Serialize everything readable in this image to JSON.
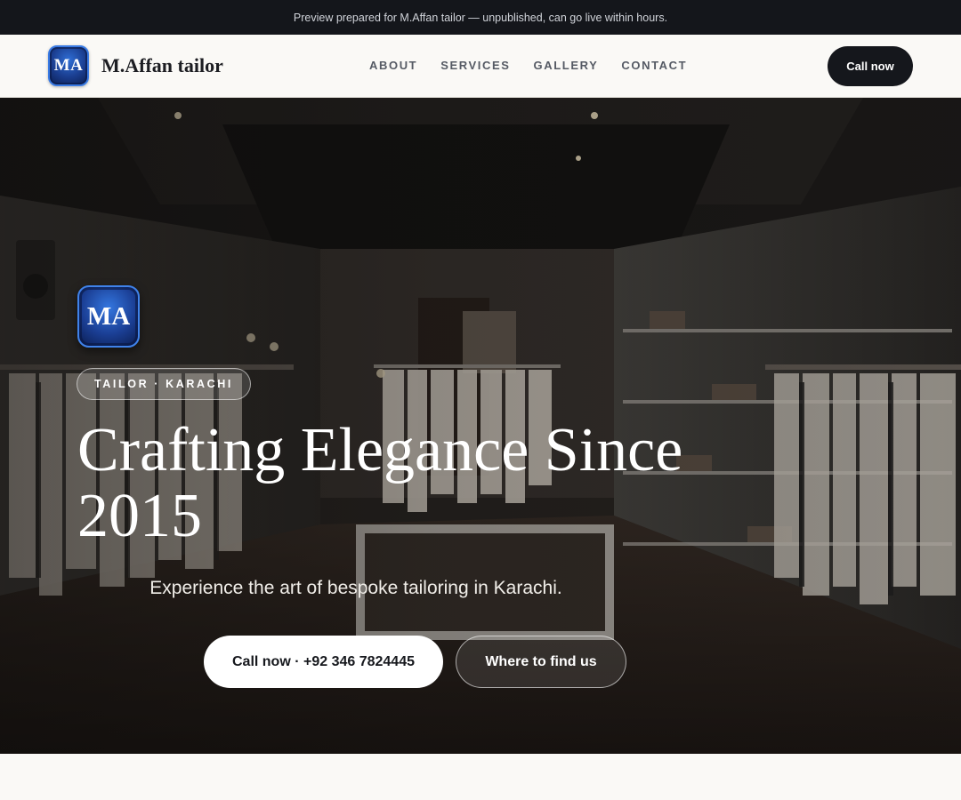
{
  "preview_banner": {
    "text": "Preview prepared for M.Affan tailor — unpublished, can go live within hours."
  },
  "header": {
    "logo_text": "MA",
    "brand_name": "M.Affan tailor",
    "nav": [
      {
        "label": "ABOUT"
      },
      {
        "label": "SERVICES"
      },
      {
        "label": "GALLERY"
      },
      {
        "label": "CONTACT"
      }
    ],
    "call_button": "Call now"
  },
  "hero": {
    "logo_text": "MA",
    "pill": "TAILOR · KARACHI",
    "title": "Crafting Elegance Since 2015",
    "subtitle": "Experience the art of bespoke tailoring in Karachi.",
    "primary_button": "Call now · +92 346 7824445",
    "secondary_button": "Where to find us"
  },
  "colors": {
    "banner_bg": "#14161b",
    "page_bg": "#faf9f6",
    "accent_dark": "#15171c",
    "logo_blue": "#1b3f95"
  }
}
